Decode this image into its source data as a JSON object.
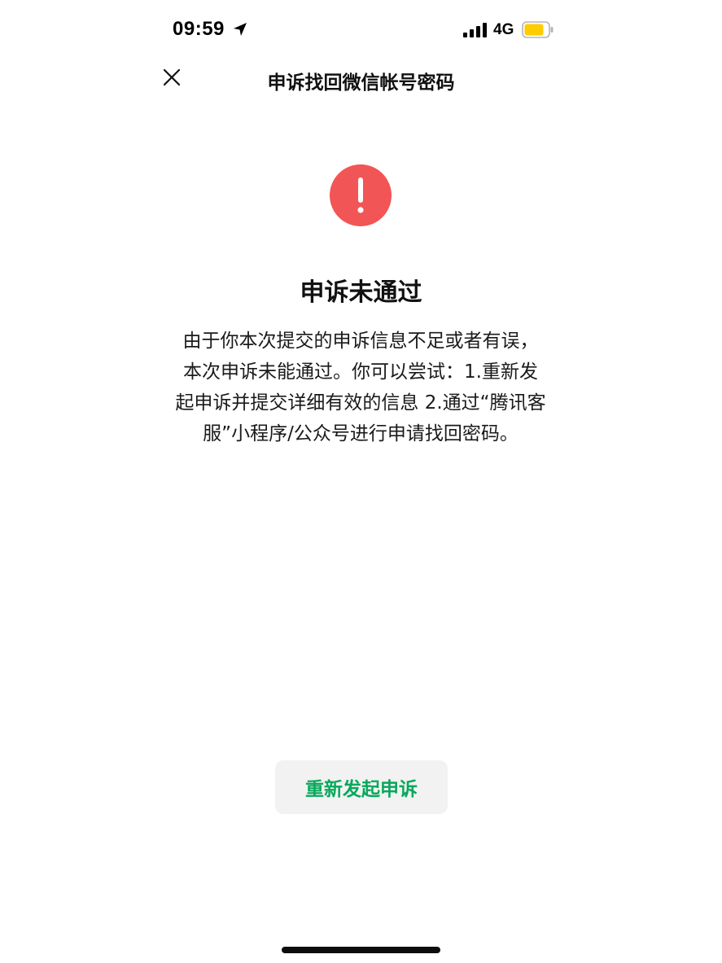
{
  "status_bar": {
    "time": "09:59",
    "network": "4G",
    "battery_color": "#ffcc00"
  },
  "nav": {
    "title": "申诉找回微信帐号密码",
    "close_icon": "close-icon"
  },
  "result": {
    "icon": "exclamation-icon",
    "icon_color": "#f25555",
    "title": "申诉未通过",
    "description": "由于你本次提交的申诉信息不足或者有误，本次申诉未能通过。你可以尝试：1.重新发起申诉并提交详细有效的信息 2.通过“腾讯客服”小程序/公众号进行申请找回密码。"
  },
  "actions": {
    "retry_label": "重新发起申诉",
    "retry_color": "#07a85c"
  }
}
